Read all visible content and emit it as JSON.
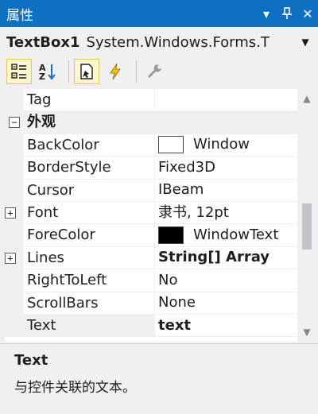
{
  "window": {
    "title": "属性"
  },
  "object_selector": {
    "name": "TextBox1",
    "type": "System.Windows.Forms.T"
  },
  "properties": [
    {
      "name": "Tag",
      "value": ""
    },
    {
      "category": "外观"
    },
    {
      "name": "BackColor",
      "value": "Window",
      "swatch": "#ffffff"
    },
    {
      "name": "BorderStyle",
      "value": "Fixed3D"
    },
    {
      "name": "Cursor",
      "value": "IBeam"
    },
    {
      "name": "Font",
      "value": "隶书, 12pt",
      "expandable": true
    },
    {
      "name": "ForeColor",
      "value": "WindowText",
      "swatch": "#000000"
    },
    {
      "name": "Lines",
      "value": "String[] Array",
      "expandable": true,
      "bold": true
    },
    {
      "name": "RightToLeft",
      "value": "No"
    },
    {
      "name": "ScrollBars",
      "value": "None"
    },
    {
      "name": "Text",
      "value": "text",
      "bold": true,
      "selected": true
    }
  ],
  "description": {
    "title": "Text",
    "text": "与控件关联的文本。"
  },
  "colors": {
    "titlebar": "#0e70c0",
    "background": "#f0f0f0",
    "active_tool": "#fff7cc"
  }
}
